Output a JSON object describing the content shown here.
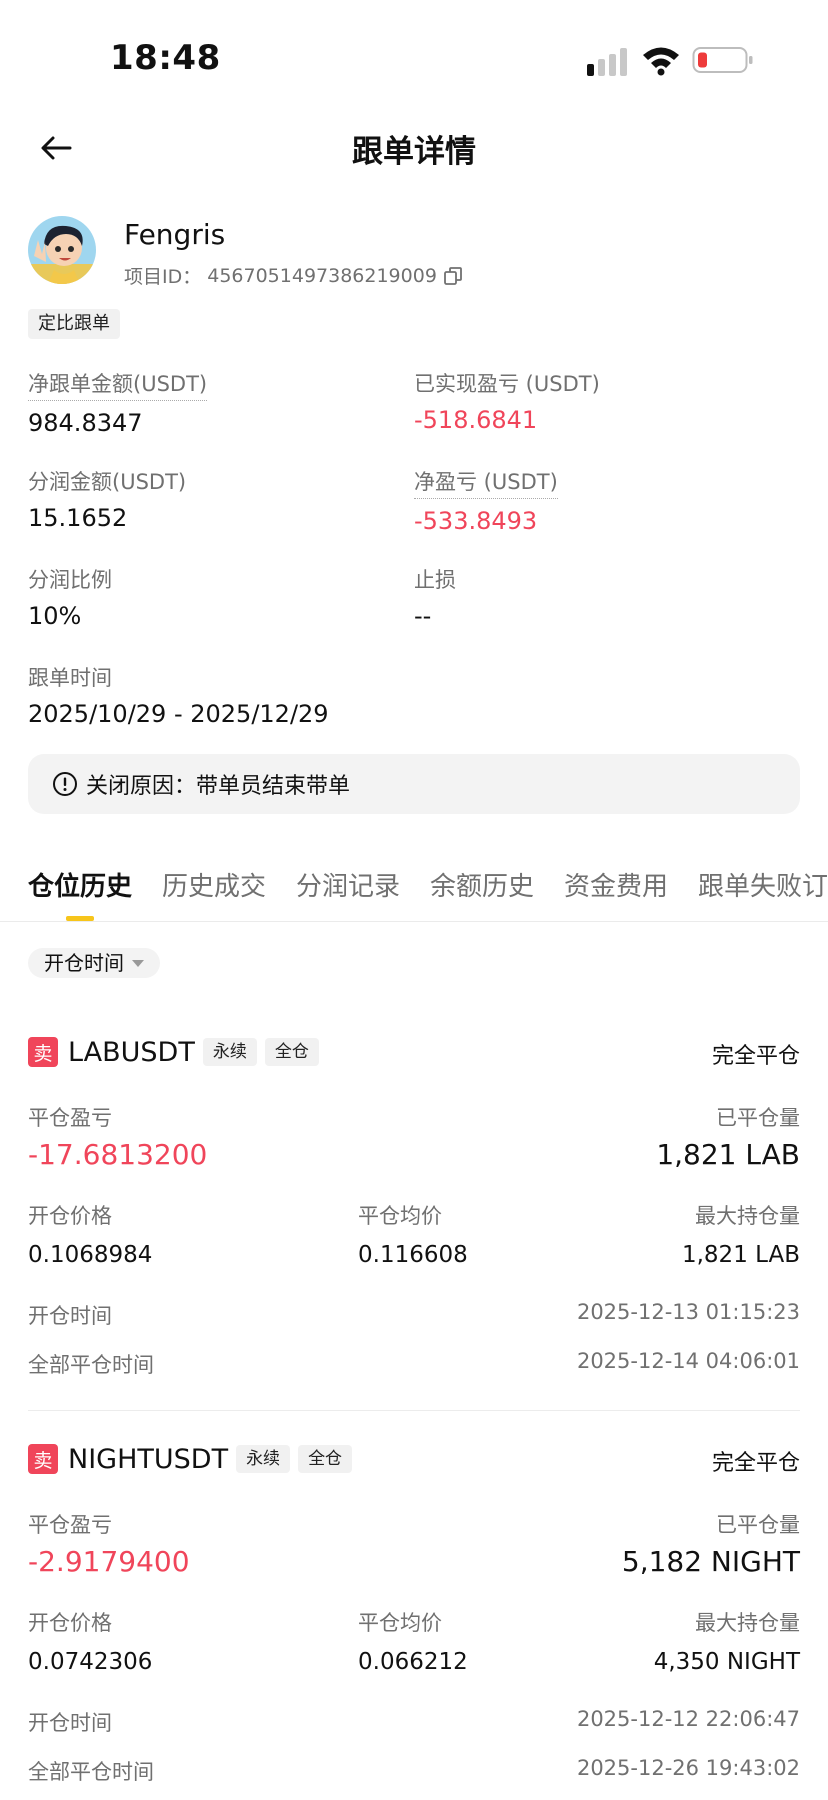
{
  "status_bar": {
    "time": "18:48"
  },
  "nav": {
    "title": "跟单详情"
  },
  "profile": {
    "username": "Fengris",
    "project_id_label": "项目ID：",
    "project_id": "4567051497386219009"
  },
  "copy_type_tag": "定比跟单",
  "stats": {
    "net_amount": {
      "label": "净跟单金额(USDT)",
      "value": "984.8347"
    },
    "realized_pnl": {
      "label": "已实现盈亏 (USDT)",
      "value": "-518.6841"
    },
    "profit_share_amount": {
      "label": "分润金额(USDT)",
      "value": "15.1652"
    },
    "net_pnl": {
      "label": "净盈亏 (USDT)",
      "value": "-533.8493"
    },
    "profit_share_ratio": {
      "label": "分润比例",
      "value": "10%"
    },
    "stop_loss": {
      "label": "止损",
      "value": "--"
    },
    "copy_time": {
      "label": "跟单时间",
      "value": "2025/10/29 - 2025/12/29"
    }
  },
  "close_reason": {
    "label": "关闭原因：",
    "value": "带单员结束带单"
  },
  "tabs": [
    "仓位历史",
    "历史成交",
    "分润记录",
    "余额历史",
    "资金费用",
    "跟单失败订"
  ],
  "sort": {
    "label": "开仓时间"
  },
  "labels": {
    "sell": "卖",
    "close_pnl": "平仓盈亏",
    "closed_qty": "已平仓量",
    "open_price": "开仓价格",
    "close_avg_price": "平仓均价",
    "max_position": "最大持仓量",
    "open_time": "开仓时间",
    "full_close_time": "全部平仓时间"
  },
  "positions": [
    {
      "symbol": "LABUSDT",
      "tag_perpetual": "永续",
      "tag_margin": "全仓",
      "status": "完全平仓",
      "close_pnl": "-17.6813200",
      "closed_qty": "1,821 LAB",
      "open_price": "0.1068984",
      "close_avg_price": "0.116608",
      "max_position": "1,821 LAB",
      "open_time": "2025-12-13 01:15:23",
      "full_close_time": "2025-12-14 04:06:01"
    },
    {
      "symbol": "NIGHTUSDT",
      "tag_perpetual": "永续",
      "tag_margin": "全仓",
      "status": "完全平仓",
      "close_pnl": "-2.9179400",
      "closed_qty": "5,182 NIGHT",
      "open_price": "0.0742306",
      "close_avg_price": "0.066212",
      "max_position": "4,350 NIGHT",
      "open_time": "2025-12-12 22:06:47",
      "full_close_time": "2025-12-26 19:43:02"
    }
  ]
}
